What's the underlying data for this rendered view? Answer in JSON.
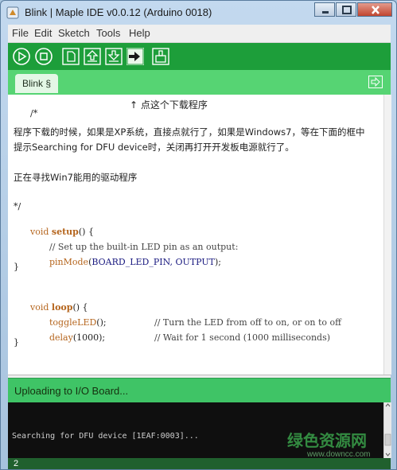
{
  "window": {
    "title": "Blink | Maple IDE v0.0.12 (Arduino 0018)",
    "controls": [
      "minimize-icon",
      "maximize-icon",
      "close-icon"
    ]
  },
  "menu": {
    "items": [
      {
        "label": "File"
      },
      {
        "label": "Edit"
      },
      {
        "label": "Sketch"
      },
      {
        "label": "Tools"
      },
      {
        "label": "Help"
      }
    ]
  },
  "toolbar": {
    "buttons": [
      {
        "name": "verify",
        "icon": "play-icon"
      },
      {
        "name": "stop",
        "icon": "stop-icon"
      },
      {
        "name": "new",
        "icon": "new-file-icon"
      },
      {
        "name": "open",
        "icon": "open-icon"
      },
      {
        "name": "save",
        "icon": "save-icon"
      },
      {
        "name": "upload",
        "icon": "upload-icon"
      },
      {
        "name": "serial-monitor",
        "icon": "serial-monitor-icon"
      }
    ]
  },
  "tabs": {
    "active": "Blink §",
    "menu_icon": "tab-menu-icon"
  },
  "editor": {
    "lines": {
      "l1_a": "/*",
      "l1_b": "↑ 点这个下载程序",
      "l2": "程序下载的时候，如果是XP系统，直接点就行了，如果是Windows7，等在下面的框中",
      "l3": "提示Searching for DFU device时，关闭再打开开发板电源就行了。",
      "l4": "正在寻找Win7能用的驱动程序",
      "l5": "*/",
      "l6_kw": "void",
      "l6_fn": "setup",
      "l6_rest": "() {",
      "l7": "// Set up the built-in LED pin as an output:",
      "l8_fn": "pinMode",
      "l8_open": "(",
      "l8_args": "BOARD_LED_PIN, OUTPUT",
      "l8_close": ");",
      "l9": "}",
      "l10_kw": "void",
      "l10_fn": "loop",
      "l10_rest": "() {",
      "l11_fn": "toggleLED",
      "l11_rest": "();",
      "l11_cmt": "// Turn the LED from off to on, or on to off",
      "l12_fn": "delay",
      "l12_rest": "(1000);",
      "l12_cmt": "// Wait for 1 second (1000 milliseconds)",
      "l13": "}"
    }
  },
  "status": {
    "message": "Uploading to I/O Board..."
  },
  "console": {
    "output": "Searching for DFU device [1EAF:0003]..."
  },
  "footer": {
    "line_number": "2"
  },
  "watermark": {
    "main": "绿色资源网",
    "sub": "www.downcc.com"
  },
  "colors": {
    "toolbar": "#1d9e3a",
    "tabbar": "#56d473",
    "status": "#3fc466",
    "console_bg": "#0f0f0f",
    "linebar": "#20602e"
  }
}
